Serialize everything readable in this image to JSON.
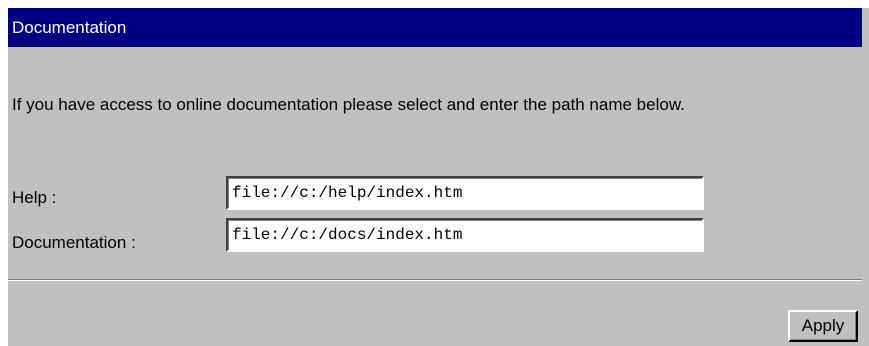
{
  "window": {
    "title": "Documentation"
  },
  "description": "If you have access to online documentation please select and enter the path name below.",
  "fields": {
    "help": {
      "label": "Help :",
      "value": "file://c:/help/index.htm"
    },
    "documentation": {
      "label": "Documentation :",
      "value": "file://c:/docs/index.htm"
    }
  },
  "actions": {
    "apply_label": "Apply"
  },
  "colors": {
    "title_bar": "#000080",
    "dialog_background": "#c0c0c0",
    "field_background": "#ffffff"
  }
}
